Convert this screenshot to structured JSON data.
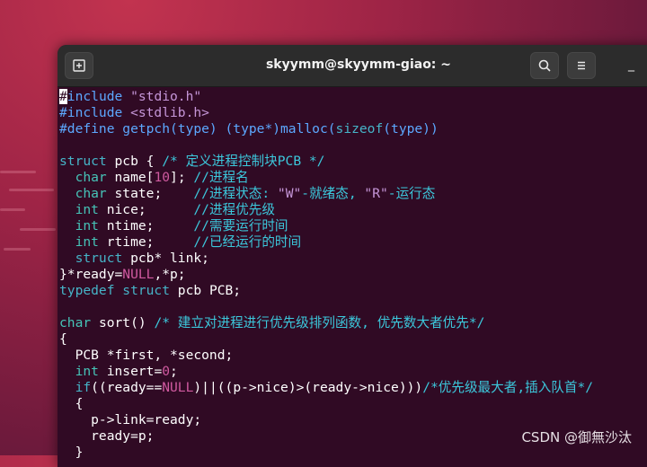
{
  "window": {
    "title": "skyymm@skyymm-giao: ~",
    "new_tab_icon": "new-tab-icon",
    "search_icon": "search-icon",
    "menu_icon": "hamburger-menu-icon",
    "minimize_label": "_"
  },
  "code_lines": [
    [
      [
        "cursor",
        "#"
      ],
      [
        "pre",
        "include "
      ],
      [
        "str",
        "\"stdio.h\""
      ]
    ],
    [
      [
        "pre",
        "#include "
      ],
      [
        "str",
        "<stdlib.h>"
      ]
    ],
    [
      [
        "pre",
        "#define getpch(type) (type*)malloc("
      ],
      [
        "kw",
        "sizeof"
      ],
      [
        "pre",
        "(type))"
      ]
    ],
    [
      [
        "txt",
        ""
      ]
    ],
    [
      [
        "kw",
        "struct"
      ],
      [
        "txt",
        " pcb { "
      ],
      [
        "com",
        "/* 定义进程控制块PCB */"
      ]
    ],
    [
      [
        "txt",
        "  "
      ],
      [
        "ty",
        "char"
      ],
      [
        "txt",
        " name["
      ],
      [
        "num",
        "10"
      ],
      [
        "txt",
        "]; "
      ],
      [
        "com",
        "//进程名"
      ]
    ],
    [
      [
        "txt",
        "  "
      ],
      [
        "ty",
        "char"
      ],
      [
        "txt",
        " state;    "
      ],
      [
        "com",
        "//进程状态: "
      ],
      [
        "str",
        "\"W\""
      ],
      [
        "com",
        "-就绪态, "
      ],
      [
        "str",
        "\"R\""
      ],
      [
        "com",
        "-运行态"
      ]
    ],
    [
      [
        "txt",
        "  "
      ],
      [
        "ty",
        "int"
      ],
      [
        "txt",
        " nice;      "
      ],
      [
        "com",
        "//进程优先级"
      ]
    ],
    [
      [
        "txt",
        "  "
      ],
      [
        "ty",
        "int"
      ],
      [
        "txt",
        " ntime;     "
      ],
      [
        "com",
        "//需要运行时间"
      ]
    ],
    [
      [
        "txt",
        "  "
      ],
      [
        "ty",
        "int"
      ],
      [
        "txt",
        " rtime;     "
      ],
      [
        "com",
        "//已经运行的时间"
      ]
    ],
    [
      [
        "txt",
        "  "
      ],
      [
        "kw",
        "struct"
      ],
      [
        "txt",
        " pcb* link;"
      ]
    ],
    [
      [
        "txt",
        "}*ready="
      ],
      [
        "num",
        "NULL"
      ],
      [
        "txt",
        ",*p;"
      ]
    ],
    [
      [
        "kw",
        "typedef struct"
      ],
      [
        "txt",
        " pcb PCB;"
      ]
    ],
    [
      [
        "txt",
        ""
      ]
    ],
    [
      [
        "ty",
        "char"
      ],
      [
        "txt",
        " sort() "
      ],
      [
        "com",
        "/* 建立对进程进行优先级排列函数, 优先数大者优先*/"
      ]
    ],
    [
      [
        "txt",
        "{"
      ]
    ],
    [
      [
        "txt",
        "  PCB *first, *second;"
      ]
    ],
    [
      [
        "txt",
        "  "
      ],
      [
        "ty",
        "int"
      ],
      [
        "txt",
        " insert="
      ],
      [
        "num",
        "0"
      ],
      [
        "txt",
        ";"
      ]
    ],
    [
      [
        "txt",
        "  "
      ],
      [
        "kw",
        "if"
      ],
      [
        "txt",
        "((ready=="
      ],
      [
        "num",
        "NULL"
      ],
      [
        "txt",
        ")||((p->nice)>(ready->nice)))"
      ],
      [
        "com",
        "/*优先级最大者,插入队首*/"
      ]
    ],
    [
      [
        "txt",
        "  {"
      ]
    ],
    [
      [
        "txt",
        "    p->link=ready;"
      ]
    ],
    [
      [
        "txt",
        "    ready=p;"
      ]
    ],
    [
      [
        "txt",
        "  }"
      ]
    ]
  ],
  "watermark": "CSDN @御無沙汰",
  "colors": {
    "terminal_bg": "#300a24",
    "comment": "#3cc8dc",
    "string": "#c596d8",
    "number": "#d05aa0",
    "keyword": "#46b4c8"
  }
}
